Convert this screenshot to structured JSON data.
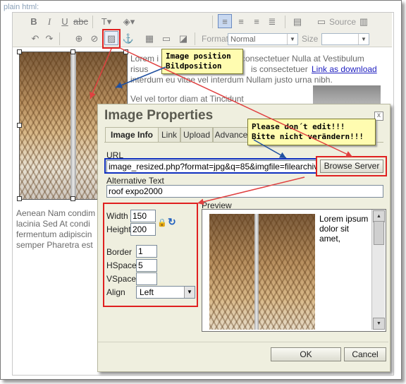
{
  "page": {
    "label": "plain html:"
  },
  "toolbar": {
    "source_label": "Source",
    "format_label": "Format",
    "format_value": "Normal",
    "size_label": "Size",
    "size_value": ""
  },
  "document": {
    "lines": [
      "Lorem i",
      "risus",
      "interdum eu vitae vel interdum Nullam justo urna nibh.",
      "Vel vel tortor diam at Tincidunt"
    ],
    "line1_rest": "consectetuer Nulla at Vestibulum",
    "line2_mid": "is consectetuer",
    "link_text": "Link as download",
    "lower_lines": [
      "Aenean Nam condim",
      "lacinia Sed At condi",
      "fermentum adipiscin",
      "semper Pharetra est"
    ]
  },
  "callouts": {
    "image_position": [
      "Image position",
      "Bildposition"
    ],
    "dont_edit": [
      "Please don´t edit!!!",
      "Bitte nicht verändern!!!"
    ]
  },
  "dialog": {
    "title": "Image Properties",
    "close_glyph": "x",
    "tabs": [
      "Image Info",
      "Link",
      "Upload",
      "Advance"
    ],
    "url_label": "URL",
    "url_value": "image_resized.php?format=jpg&q=85&imgfile=filearchive/3903",
    "browse_label": "Browse Server",
    "alt_label": "Alternative Text",
    "alt_value": "roof expo2000",
    "width_label": "Width",
    "width_value": "150",
    "height_label": "Height",
    "height_value": "200",
    "border_label": "Border",
    "border_value": "1",
    "hspace_label": "HSpace",
    "hspace_value": "5",
    "vspace_label": "VSpace",
    "vspace_value": "",
    "align_label": "Align",
    "align_value": "Left",
    "preview_label": "Preview",
    "preview_text": "Lorem ipsum dolor sit amet,",
    "ok_label": "OK",
    "cancel_label": "Cancel"
  },
  "colors": {
    "highlight_red": "#e02020",
    "highlight_blue": "#1030c0",
    "callout_fill": "#fffcb0",
    "link": "#2020c0"
  },
  "icons": [
    "bold-icon",
    "italic-icon",
    "underline-icon",
    "strike-icon",
    "text-color-icon",
    "bg-color-icon",
    "align-left-icon",
    "align-center-icon",
    "align-right-icon",
    "justify-icon",
    "paste-icon",
    "source-icon",
    "undo-icon",
    "redo-icon",
    "link-icon",
    "unlink-icon",
    "image-icon",
    "anchor-icon",
    "table-icon",
    "rule-icon",
    "box-icon",
    "lock-icon",
    "reset-size-icon"
  ]
}
